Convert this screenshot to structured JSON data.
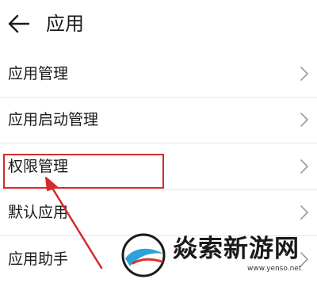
{
  "header": {
    "title": "应用",
    "back_icon": "arrow-left-icon"
  },
  "settings_list": {
    "items": [
      {
        "label": "应用管理"
      },
      {
        "label": "应用启动管理"
      },
      {
        "label": "权限管理"
      },
      {
        "label": "默认应用"
      },
      {
        "label": "应用助手"
      }
    ],
    "chevron_icon": "chevron-right-icon",
    "highlighted_item": "权限管理"
  },
  "annotation": {
    "box_color": "#d42b2b",
    "arrow_color": "#d42b2b"
  },
  "watermark": {
    "text": "焱索新游网",
    "url": "www.yenso.net"
  }
}
